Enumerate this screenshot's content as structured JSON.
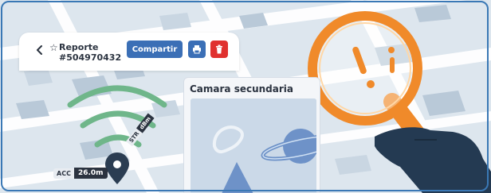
{
  "report": {
    "title": "Reporte",
    "id": "#504970432",
    "share_label": "Compartir"
  },
  "camera": {
    "title": "Camara secundaria"
  },
  "signal": {
    "acc_label": "ACC",
    "acc_value": "26.0m",
    "str_label": "STR",
    "str_value": "dBm"
  },
  "icons": {
    "back": "chevron-left-icon",
    "favorite": "star-outline-icon",
    "print": "printer-icon",
    "delete": "trash-icon",
    "pin": "map-pin-icon",
    "wifi": "wifi-signal-icon",
    "magnifier": "magnifying-glass-icon"
  },
  "colors": {
    "primary": "#3b6fb6",
    "danger": "#e0312f",
    "signal_green": "#6fb68a",
    "pin": "#2b3d52",
    "magnifier_orange": "#f08a2a",
    "hand": "#243a52"
  }
}
